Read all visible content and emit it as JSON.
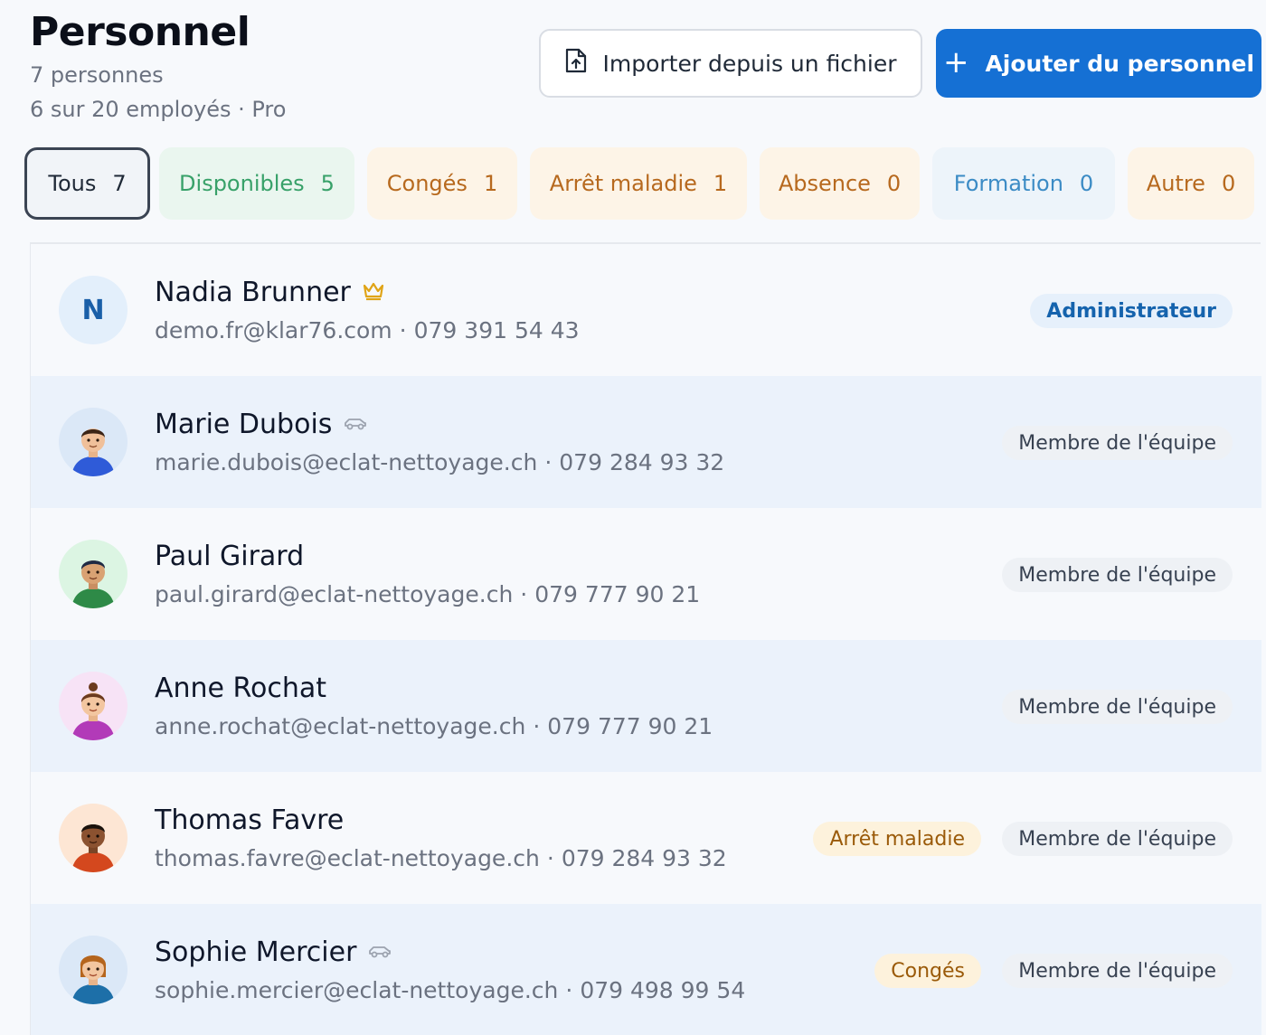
{
  "header": {
    "title": "Personnel",
    "people_count": "7 personnes",
    "plan_info": "6 sur 20 employés · Pro"
  },
  "actions": {
    "import_label": "Importer depuis un fichier",
    "add_label": "Ajouter du personnel",
    "add_icon": "+"
  },
  "filters": [
    {
      "label": "Tous",
      "count": "7"
    },
    {
      "label": "Disponibles",
      "count": "5"
    },
    {
      "label": "Congés",
      "count": "1"
    },
    {
      "label": "Arrêt maladie",
      "count": "1"
    },
    {
      "label": "Absence",
      "count": "0"
    },
    {
      "label": "Formation",
      "count": "0"
    },
    {
      "label": "Autre",
      "count": "0"
    }
  ],
  "staff": [
    {
      "name": "Nadia Brunner",
      "initial": "N",
      "email": "demo.fr@klar76.com",
      "phone": "079 391 54 43",
      "role": "Administrateur",
      "icon": "crown-icon"
    },
    {
      "name": "Marie Dubois",
      "email": "marie.dubois@eclat-nettoyage.ch",
      "phone": "079 284 93 32",
      "role": "Membre de l'équipe",
      "icon": "car-icon"
    },
    {
      "name": "Paul Girard",
      "email": "paul.girard@eclat-nettoyage.ch",
      "phone": "079 777 90 21",
      "role": "Membre de l'équipe"
    },
    {
      "name": "Anne Rochat",
      "email": "anne.rochat@eclat-nettoyage.ch",
      "phone": "079 777 90 21",
      "role": "Membre de l'équipe"
    },
    {
      "name": "Thomas Favre",
      "email": "thomas.favre@eclat-nettoyage.ch",
      "phone": "079 284 93 32",
      "role": "Membre de l'équipe",
      "status": "Arrêt maladie"
    },
    {
      "name": "Sophie Mercier",
      "email": "sophie.mercier@eclat-nettoyage.ch",
      "phone": "079 498 99 54",
      "role": "Membre de l'équipe",
      "status": "Congés",
      "icon": "car-icon"
    }
  ],
  "contact_separator": "·",
  "colors": {
    "primary": "#1570d4",
    "available": "#38a169",
    "warning": "#b7691e",
    "info": "#3b8bc5",
    "crown": "#e0a416"
  }
}
